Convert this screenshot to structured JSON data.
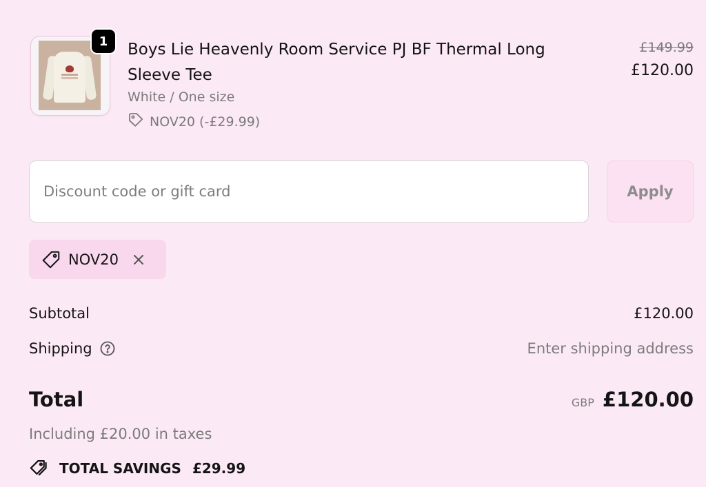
{
  "product": {
    "quantity": "1",
    "title": "Boys Lie Heavenly Room Service PJ BF Thermal Long Sleeve Tee",
    "variant": "White / One size",
    "discount_applied": "NOV20 (-£29.99)",
    "original_price": "£149.99",
    "price": "£120.00",
    "thumbnail_icon": "product-image"
  },
  "discount": {
    "placeholder": "Discount code or gift card",
    "value": "",
    "apply_label": "Apply"
  },
  "applied_code": {
    "code": "NOV20",
    "tag_icon": "tag-icon",
    "remove_icon": "close-icon"
  },
  "summary": {
    "subtotal_label": "Subtotal",
    "subtotal_value": "£120.00",
    "shipping_label": "Shipping",
    "shipping_value": "Enter shipping address",
    "shipping_help_icon": "question-circle-icon",
    "total_label": "Total",
    "currency": "GBP",
    "total_value": "£120.00",
    "taxes_note": "Including £20.00 in taxes",
    "savings_label": "TOTAL SAVINGS",
    "savings_value": "£29.99",
    "savings_icon": "tags-icon"
  },
  "colors": {
    "background": "#fce9f6",
    "chip": "#f9d8ee",
    "apply_button": "#fbe1f2",
    "text": "#141414",
    "muted_text": "#7b7b7b"
  }
}
